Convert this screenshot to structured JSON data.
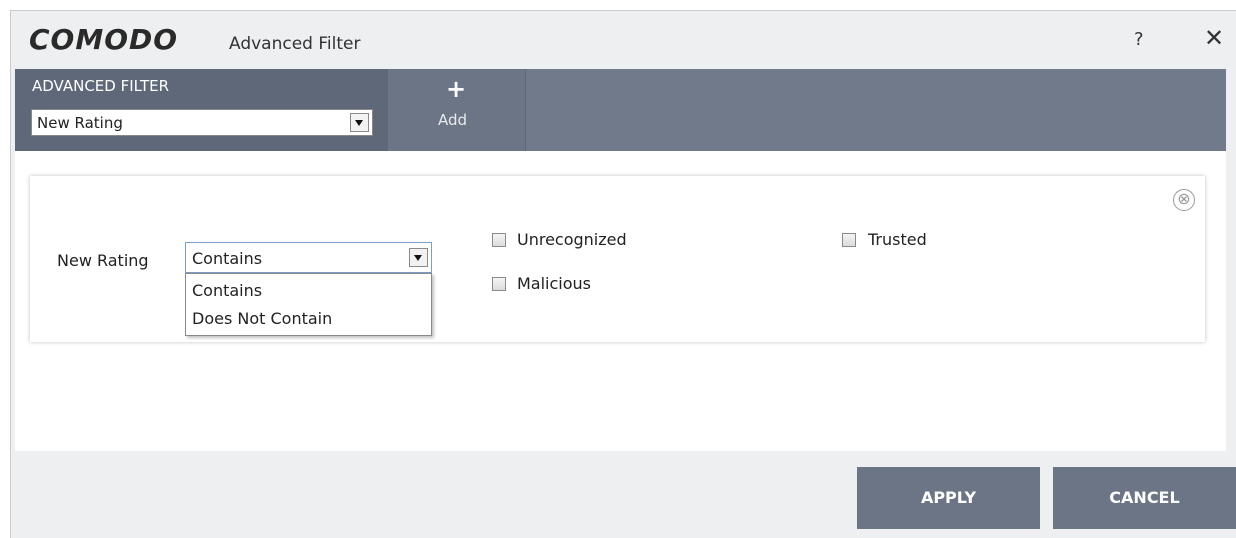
{
  "window": {
    "logo": "COMODO",
    "title": "Advanced Filter",
    "help_label": "?",
    "close_label": "✕"
  },
  "header": {
    "filter_label": "ADVANCED FILTER",
    "filter_selected": "New Rating",
    "add_label": "Add",
    "add_icon": "+"
  },
  "rule": {
    "label": "New Rating",
    "condition_selected": "Contains",
    "condition_options": [
      "Contains",
      "Does Not Contain"
    ],
    "remove_icon": "⊗",
    "checkboxes": [
      {
        "label": "Unrecognized",
        "checked": false
      },
      {
        "label": "Trusted",
        "checked": false
      },
      {
        "label": "Malicious",
        "checked": false
      }
    ]
  },
  "footer": {
    "apply_label": "APPLY",
    "cancel_label": "CANCEL"
  },
  "colors": {
    "band": "#707a8a",
    "filter_panel": "#5e6878",
    "button": "#6b7585",
    "window_bg": "#eeeff1"
  }
}
